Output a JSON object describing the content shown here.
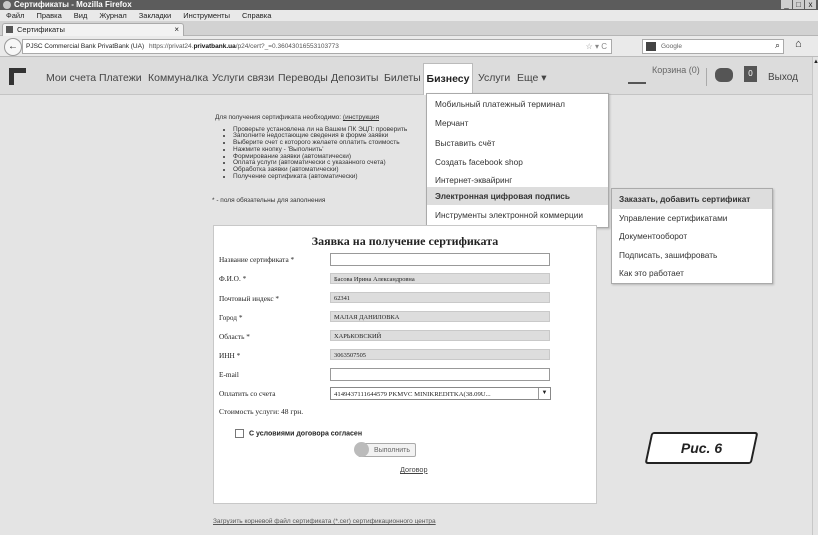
{
  "window": {
    "title": "Сертификаты - Mozilla Firefox",
    "buttons": [
      "_",
      "□",
      "x"
    ]
  },
  "menubar": [
    "Файл",
    "Правка",
    "Вид",
    "Журнал",
    "Закладки",
    "Инструменты",
    "Справка"
  ],
  "tab": {
    "label": "Сертификаты",
    "close": "×"
  },
  "addressbar": {
    "site": "PJSC Commercial Bank PrivatBank (UA)",
    "url_pre": "https://privat24.",
    "url_domain": "privatbank.ua",
    "url_post": "/p24/cert?_=0.36043016553103773",
    "controls": "☆ ▾ C"
  },
  "search": {
    "placeholder": "Google"
  },
  "nav": {
    "items": [
      "Мои счета",
      "Платежи",
      "Коммуналка",
      "Услуги связи",
      "Переводы",
      "Депозиты",
      "Билеты",
      "Бизнесу",
      "Услуги",
      "Еще ▾"
    ],
    "cart": "Корзина (0)",
    "bell_count": "0",
    "exit": "Выход"
  },
  "instructions": {
    "heading": "Для получения сертификата необходимо:",
    "link": "(инструкция",
    "steps": [
      "Проверьте установлена ли на Вашем ПК ЭЦП:  проверить",
      "Заполните недостающие сведения в форме заявки",
      "Выберите счет с которого желаете оплатить стоимость",
      "Нажмите кнопку - 'Выполнить'",
      "Формирование заявки (автоматически)",
      "Оплата услуги (автоматически с указанного счета)",
      "Обработка заявки (автоматически)",
      "Получение сертификата (автоматически)"
    ],
    "required_note": "* - поля обязательны для заполнения"
  },
  "business_menu": [
    "Мобильный платежный терминал",
    "Мерчант",
    "Выставить счёт",
    "Создать facebook shop",
    "Интернет-эквайринг",
    "Электронная цифровая подпись",
    "Инструменты электронной коммерции"
  ],
  "eds_submenu": [
    "Заказать, добавить сертификат",
    "Управление сертификатами",
    "Документооборот",
    "Подписать, зашифровать",
    "Как это работает"
  ],
  "form": {
    "title": "Заявка на получение сертификата",
    "fields": [
      {
        "label": "Название сертификата *",
        "value": ""
      },
      {
        "label": "Ф.И.О. *",
        "value": "Басова Ирина Александровна"
      },
      {
        "label": "Почтовый индекс *",
        "value": "62341"
      },
      {
        "label": "Город *",
        "value": "МАЛАЯ ДАНИЛОВКА"
      },
      {
        "label": "Область *",
        "value": "ХАРЬКОВСКИЙ"
      },
      {
        "label": "ИНН *",
        "value": "3063507505"
      },
      {
        "label": "E-mail",
        "value": ""
      }
    ],
    "account_label": "Оплатить со счета",
    "account_value": "4149437111644579 PKMVC MINIKREDITKA(38.09U...",
    "price": "Стоимость услуги: 48 грн.",
    "agree": "С условиями договора согласен",
    "execute": "Выполнить",
    "contract": "Договор"
  },
  "footer_link": "Загрузить корневой файл сертификата (*.cer) сертификационного центра",
  "figure_label": "Рис. 6"
}
